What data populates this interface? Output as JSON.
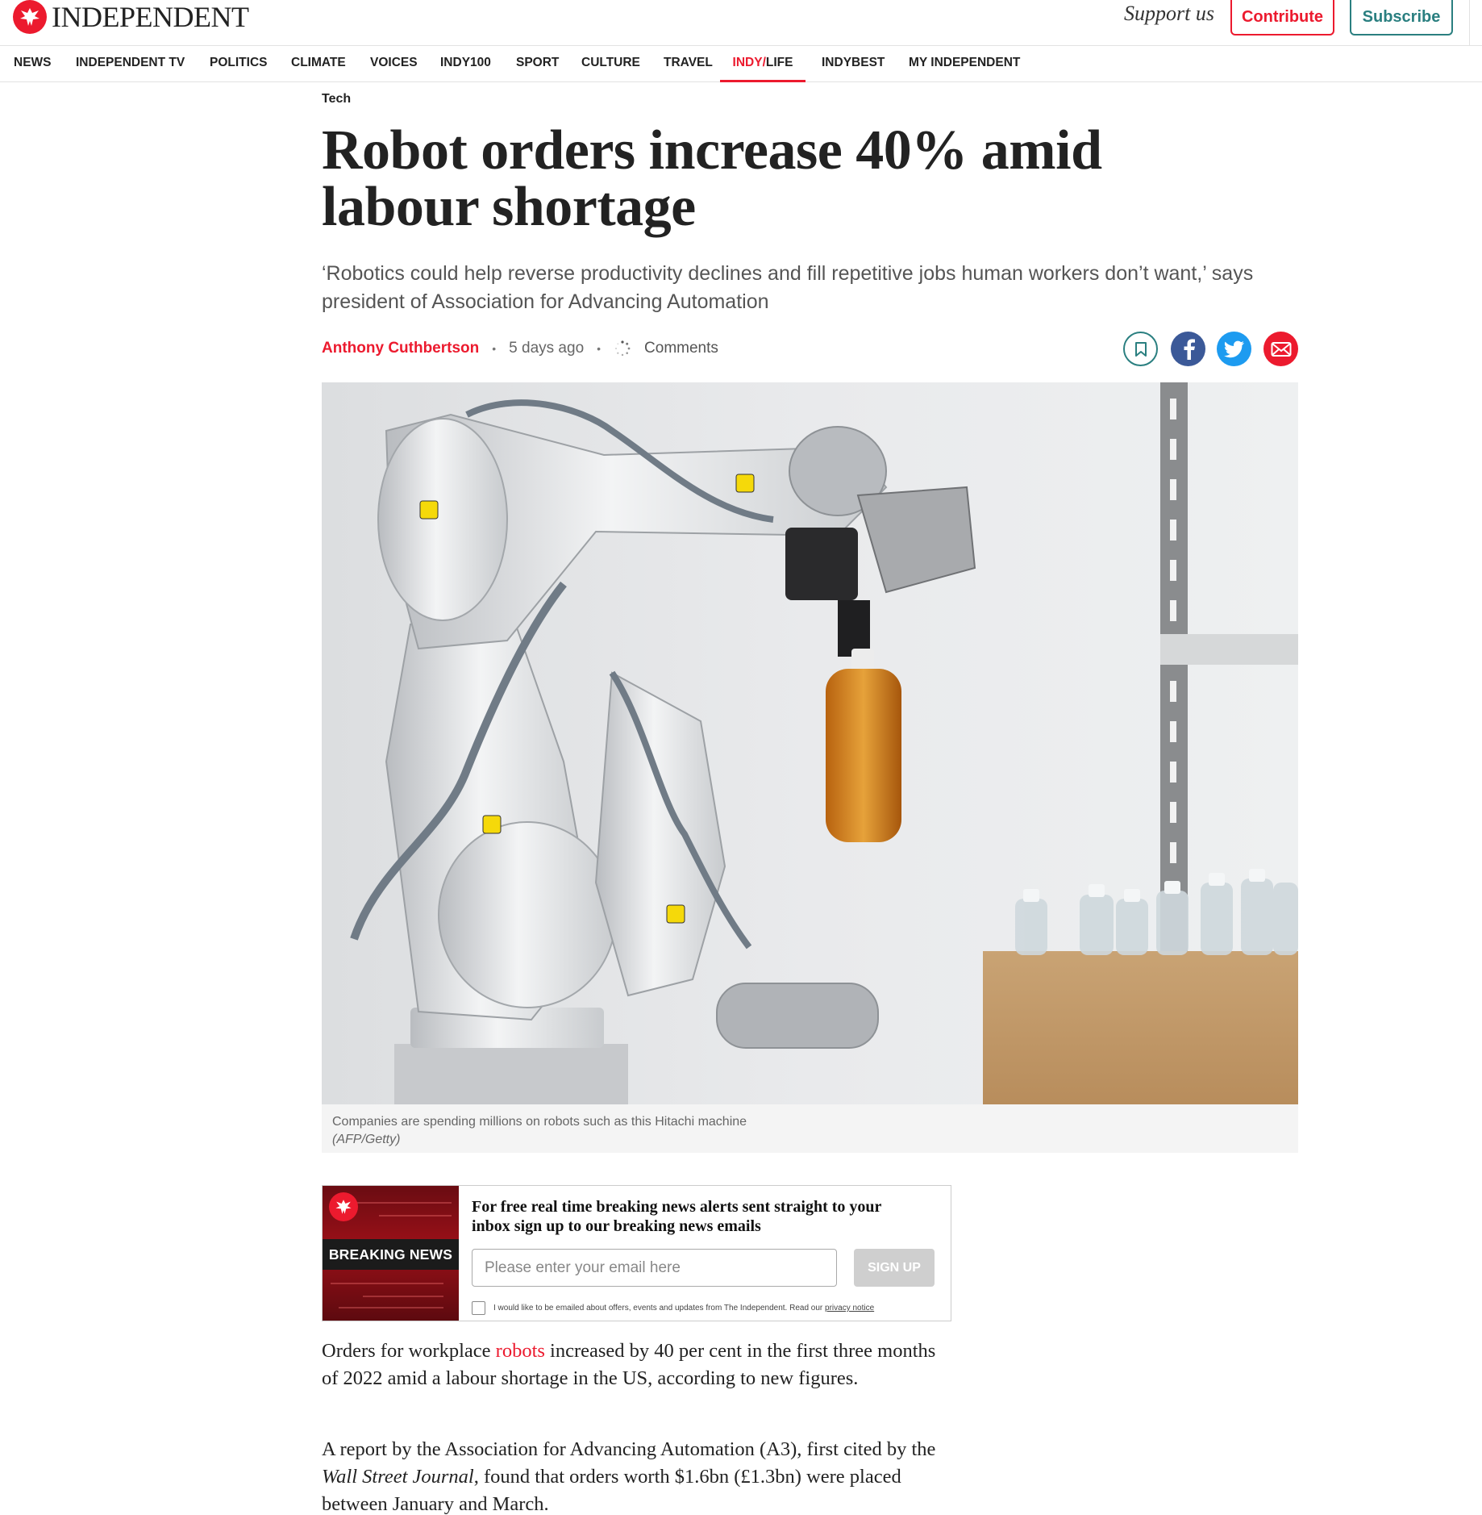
{
  "header": {
    "logo_text": "INDEPENDENT",
    "support_text": "Support us",
    "contribute_label": "Contribute",
    "subscribe_label": "Subscribe",
    "brand_color": "#ec1a2e",
    "teal_color": "#2a7f80"
  },
  "nav": {
    "items": [
      {
        "label": "NEWS"
      },
      {
        "label": "INDEPENDENT TV"
      },
      {
        "label": "POLITICS"
      },
      {
        "label": "CLIMATE"
      },
      {
        "label": "VOICES"
      },
      {
        "label": "INDY100"
      },
      {
        "label": "SPORT"
      },
      {
        "label": "CULTURE"
      },
      {
        "label": "TRAVEL"
      },
      {
        "label_prefix": "INDY/",
        "label_suffix": "LIFE",
        "active": true
      },
      {
        "label": "INDYBEST"
      },
      {
        "label": "MY INDEPENDENT"
      }
    ]
  },
  "article": {
    "section": "Tech",
    "headline_line1": "Robot orders increase 40% amid",
    "headline_line2": "labour shortage",
    "standfirst": "‘Robotics could help reverse productivity declines and fill repetitive jobs human workers don’t want,’ says president of Association for Advancing Automation",
    "author": "Anthony Cuthbertson",
    "date": "5 days ago",
    "comments_label": "Comments",
    "share_icons": [
      "bookmark-icon",
      "facebook-icon",
      "twitter-icon",
      "email-icon"
    ],
    "image": {
      "caption": "Companies are spending millions on robots such as this Hitachi machine",
      "credit": "(AFP/Getty)"
    }
  },
  "newsletter": {
    "badge": "BREAKING NEWS",
    "title": "For free real time breaking news alerts sent straight to your inbox sign up to our breaking news emails",
    "email_placeholder": "Please enter your email here",
    "signup_label": "SIGN UP",
    "consent_text": "I would like to be emailed about offers, events and updates from The Independent. Read our ",
    "privacy_link": "privacy notice"
  },
  "body": {
    "p1_before": "Orders for workplace ",
    "p1_link": "robots",
    "p1_after": " increased by 40 per cent in the first three months of 2022 amid a labour shortage in the US, according to new figures.",
    "p2_before": "A report by the Association for Advancing Automation (A3), first cited by the ",
    "p2_italic": "Wall Street Journal",
    "p2_after": ", found that orders worth $1.6bn (£1.3bn) were placed between January and March."
  }
}
